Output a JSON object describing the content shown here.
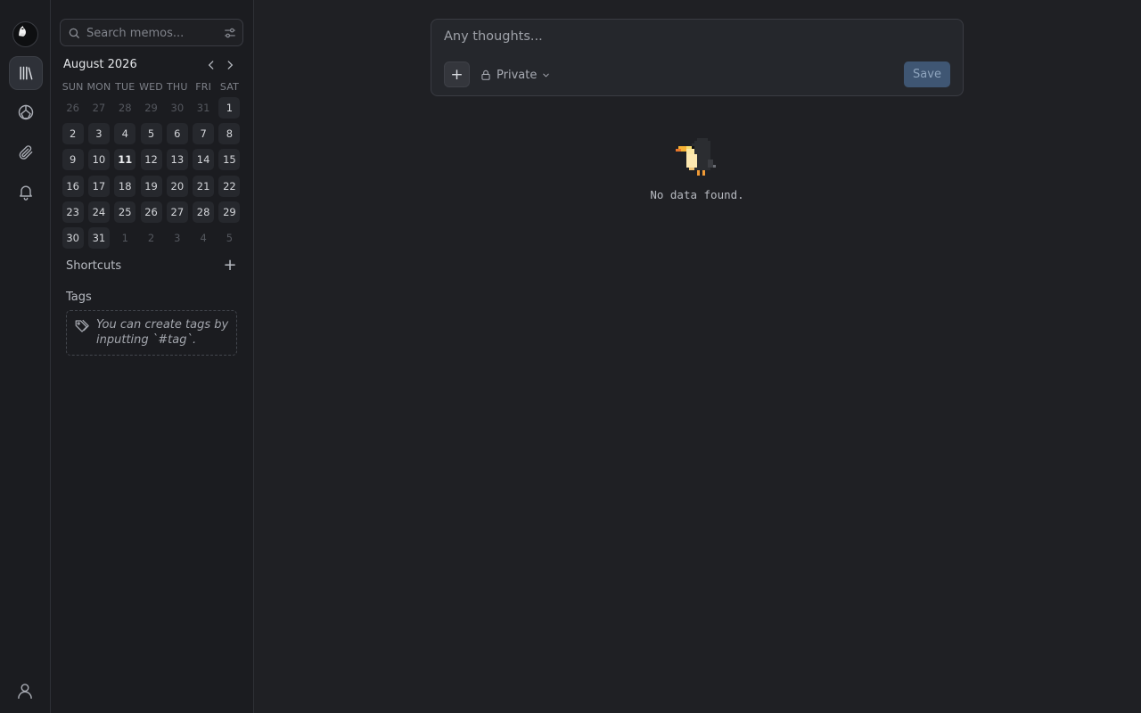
{
  "search": {
    "placeholder": "Search memos..."
  },
  "calendar": {
    "title": "August 2026",
    "weekdays": [
      "SUN",
      "MON",
      "TUE",
      "WED",
      "THU",
      "FRI",
      "SAT"
    ],
    "today": 11,
    "days": [
      {
        "label": "26",
        "muted": true
      },
      {
        "label": "27",
        "muted": true
      },
      {
        "label": "28",
        "muted": true
      },
      {
        "label": "29",
        "muted": true
      },
      {
        "label": "30",
        "muted": true
      },
      {
        "label": "31",
        "muted": true
      },
      {
        "label": "1",
        "muted": false
      },
      {
        "label": "2",
        "muted": false
      },
      {
        "label": "3",
        "muted": false
      },
      {
        "label": "4",
        "muted": false
      },
      {
        "label": "5",
        "muted": false
      },
      {
        "label": "6",
        "muted": false
      },
      {
        "label": "7",
        "muted": false
      },
      {
        "label": "8",
        "muted": false
      },
      {
        "label": "9",
        "muted": false
      },
      {
        "label": "10",
        "muted": false
      },
      {
        "label": "11",
        "muted": false
      },
      {
        "label": "12",
        "muted": false
      },
      {
        "label": "13",
        "muted": false
      },
      {
        "label": "14",
        "muted": false
      },
      {
        "label": "15",
        "muted": false
      },
      {
        "label": "16",
        "muted": false
      },
      {
        "label": "17",
        "muted": false
      },
      {
        "label": "18",
        "muted": false
      },
      {
        "label": "19",
        "muted": false
      },
      {
        "label": "20",
        "muted": false
      },
      {
        "label": "21",
        "muted": false
      },
      {
        "label": "22",
        "muted": false
      },
      {
        "label": "23",
        "muted": false
      },
      {
        "label": "24",
        "muted": false
      },
      {
        "label": "25",
        "muted": false
      },
      {
        "label": "26",
        "muted": false
      },
      {
        "label": "27",
        "muted": false
      },
      {
        "label": "28",
        "muted": false
      },
      {
        "label": "29",
        "muted": false
      },
      {
        "label": "30",
        "muted": false
      },
      {
        "label": "31",
        "muted": false
      },
      {
        "label": "1",
        "muted": true
      },
      {
        "label": "2",
        "muted": true
      },
      {
        "label": "3",
        "muted": true
      },
      {
        "label": "4",
        "muted": true
      },
      {
        "label": "5",
        "muted": true
      }
    ]
  },
  "shortcuts": {
    "label": "Shortcuts",
    "add": "+"
  },
  "tags": {
    "label": "Tags",
    "empty_hint": "You can create tags by inputting `#tag`."
  },
  "editor": {
    "placeholder": "Any thoughts...",
    "add": "+",
    "visibility": "Private",
    "save": "Save"
  },
  "empty": {
    "message": "No data found."
  },
  "nav": {
    "icons": [
      "home-icon",
      "explore-icon",
      "attachments-icon",
      "notifications-icon"
    ],
    "active": "home-icon"
  },
  "colors": {
    "accent": "#3f5673",
    "background": "#1f2024",
    "sidebar": "#1b1c20"
  }
}
